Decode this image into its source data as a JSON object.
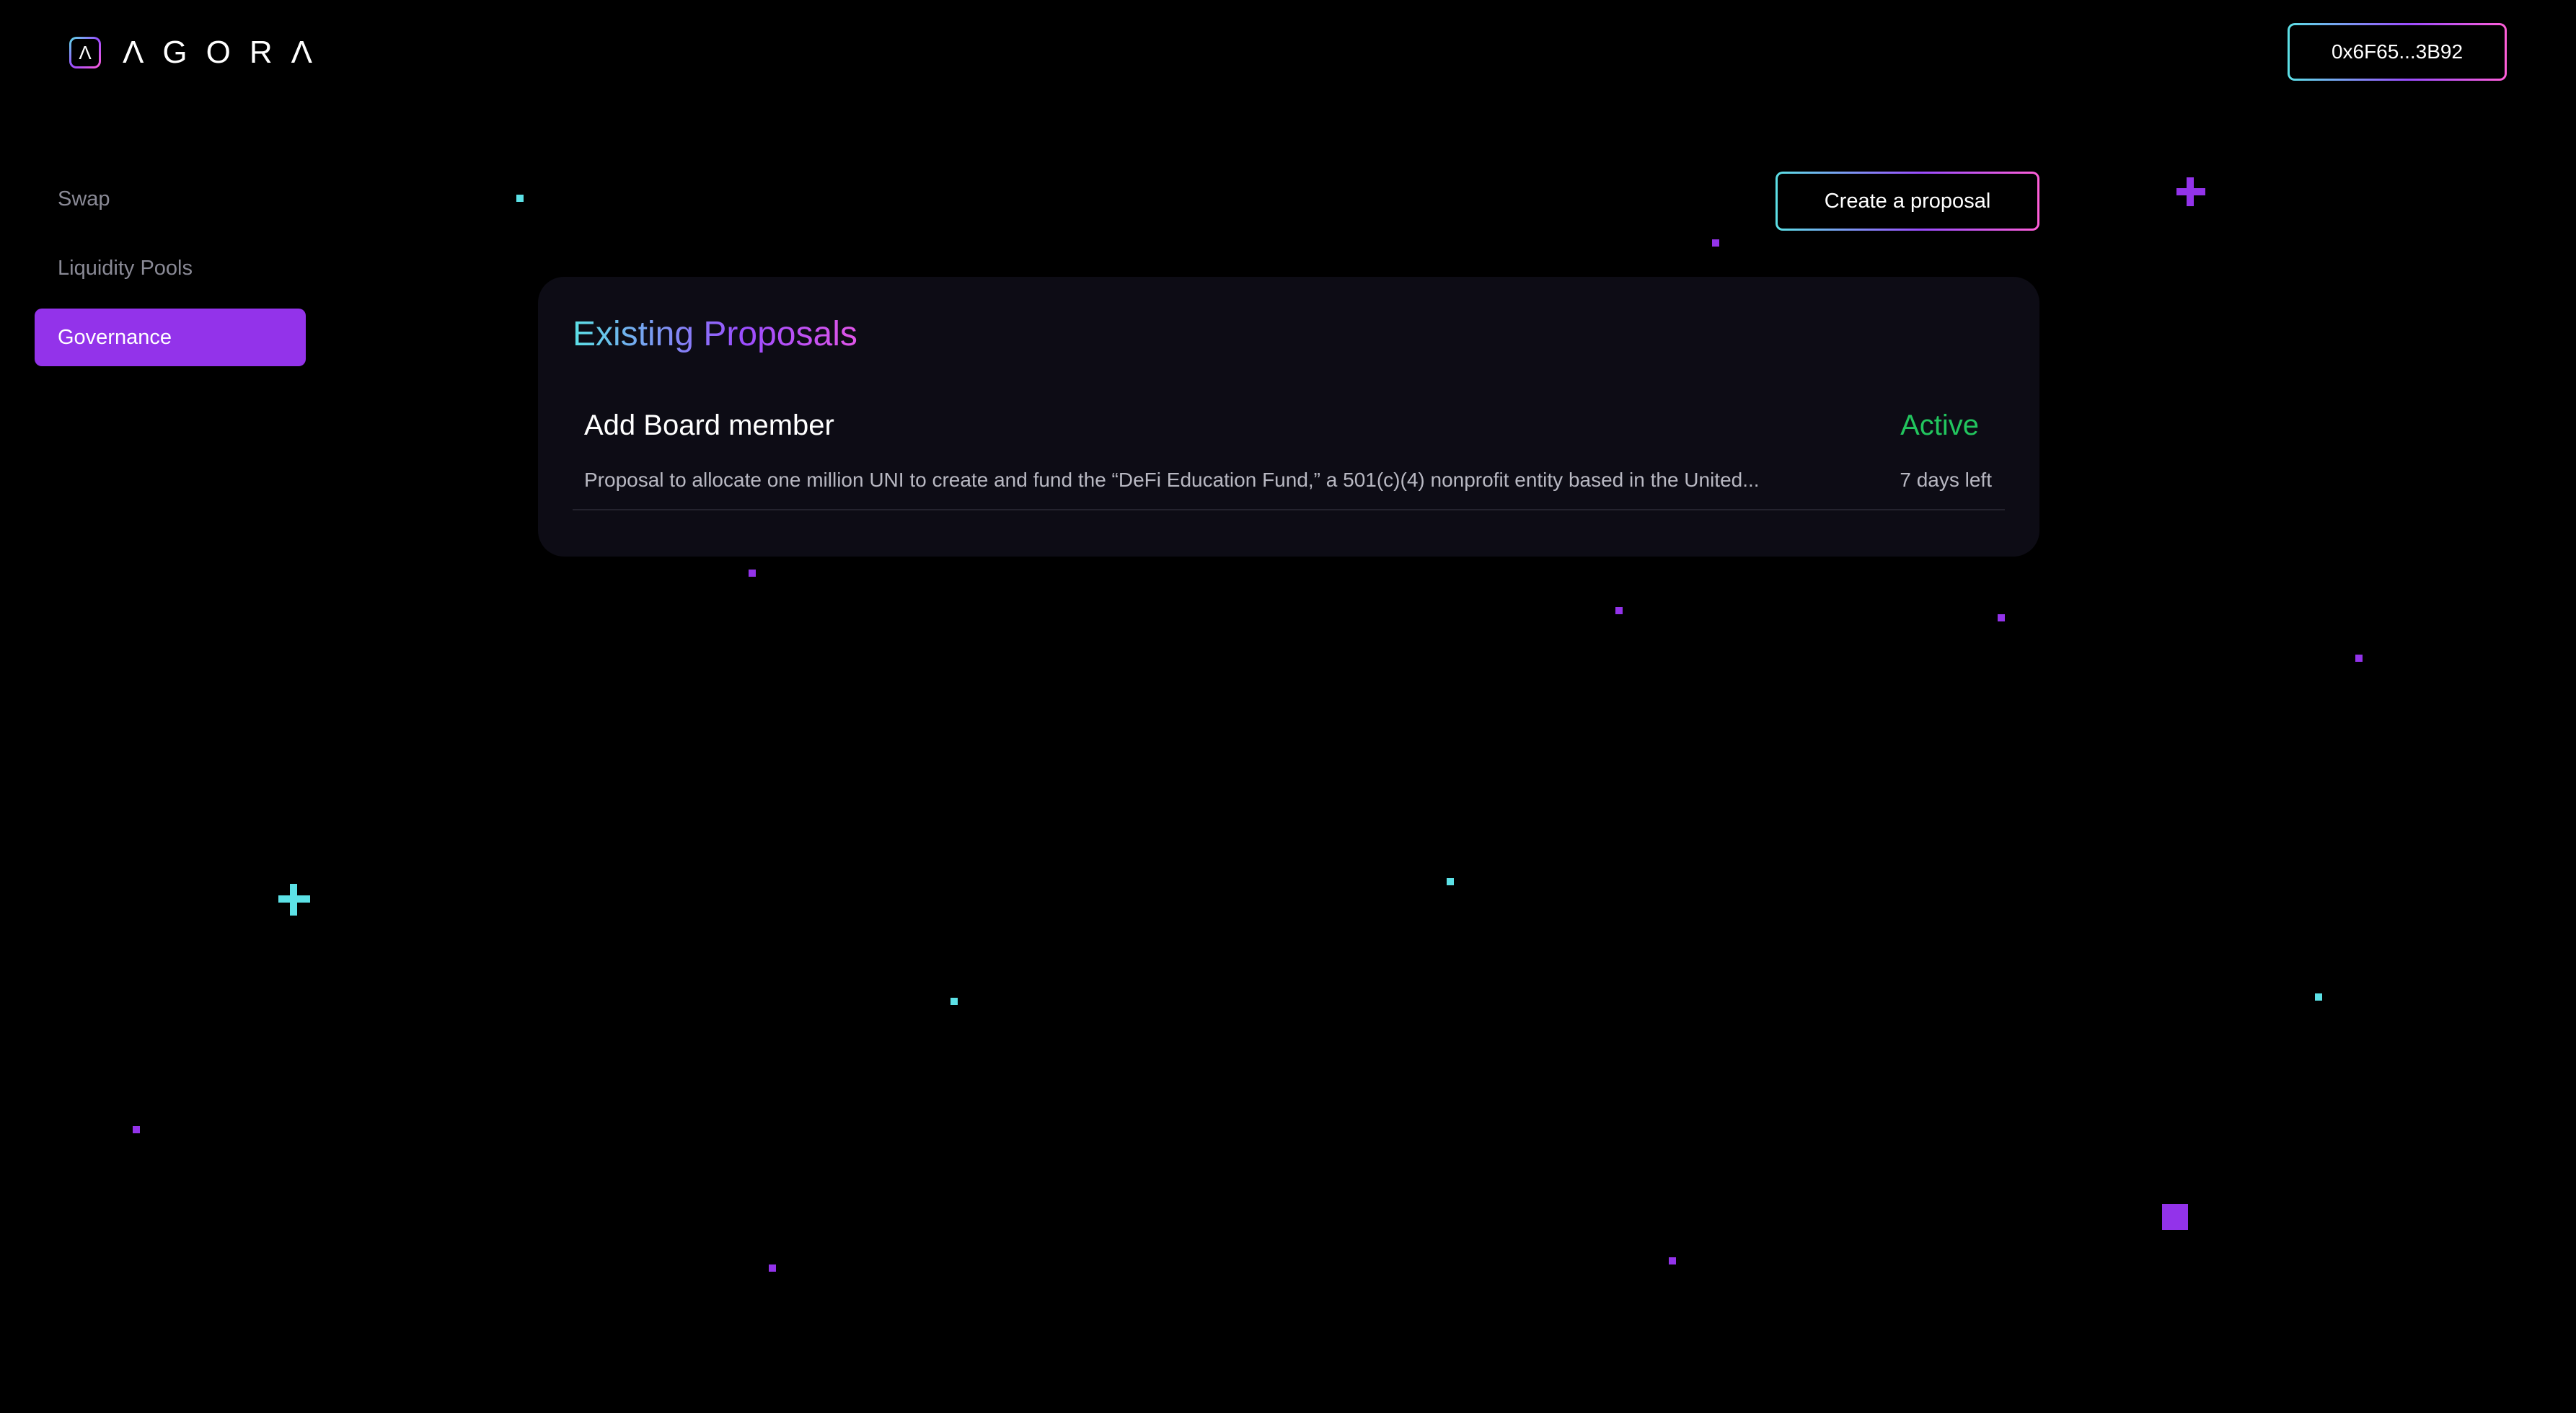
{
  "header": {
    "logo_mark": "Λ",
    "logo_text": "ΛGORΛ",
    "wallet_address": "0x6F65...3B92"
  },
  "sidebar": {
    "items": [
      {
        "label": "Swap",
        "active": false
      },
      {
        "label": "Liquidity Pools",
        "active": false
      },
      {
        "label": "Governance",
        "active": true
      }
    ]
  },
  "main": {
    "create_button_label": "Create a proposal",
    "card_title": "Existing Proposals",
    "proposals": [
      {
        "title": "Add Board member",
        "status": "Active",
        "description": "Proposal to allocate one million UNI to create and fund the “DeFi Education Fund,” a 501(c)(4) nonprofit entity based in the United...",
        "time_left": "7 days left"
      }
    ]
  },
  "colors": {
    "accent_purple": "#9333ea",
    "accent_cyan": "#5ce1e6",
    "status_active": "#22c55e",
    "card_bg": "#0d0c15"
  }
}
